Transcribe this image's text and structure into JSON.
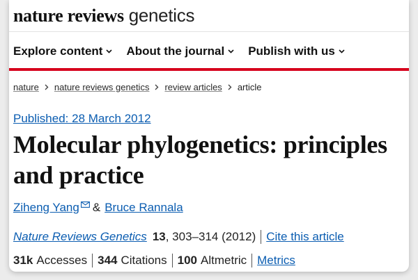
{
  "brand": {
    "bold": "nature reviews",
    "light": "genetics"
  },
  "nav": [
    {
      "label": "Explore content"
    },
    {
      "label": "About the journal"
    },
    {
      "label": "Publish with us"
    }
  ],
  "breadcrumb": [
    "nature",
    "nature reviews genetics",
    "review articles",
    "article"
  ],
  "article": {
    "published": "Published: 28 March 2012",
    "title": "Molecular phylogenetics: principles and practice",
    "authors": [
      "Ziheng Yang",
      "Bruce Rannala"
    ],
    "author_separator": "&",
    "journal": "Nature Reviews Genetics",
    "volume": "13",
    "pages_year": ", 303–314 (2012)",
    "cite_label": "Cite this article"
  },
  "metrics": {
    "accesses_value": "31k",
    "accesses_label": "Accesses",
    "citations_value": "344",
    "citations_label": "Citations",
    "altmetric_value": "100",
    "altmetric_label": "Altmetric",
    "metrics_link": "Metrics"
  },
  "colors": {
    "accent_red": "#d6001c",
    "link_blue": "#0b5db1"
  },
  "icons": {
    "nav_dropdown": "chevron-down-icon",
    "breadcrumb_separator": "chevron-right-icon",
    "author_email": "envelope-icon"
  }
}
